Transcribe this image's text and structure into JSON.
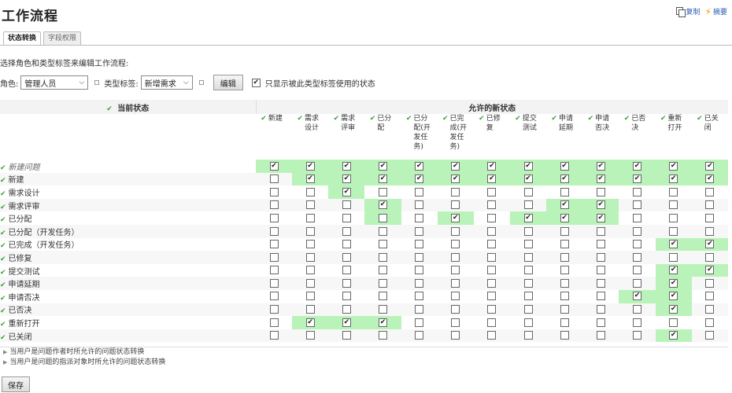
{
  "page_title": "工作流程",
  "top_actions": {
    "copy": "复制",
    "extra": "摘要"
  },
  "tabs": [
    {
      "label": "状态转换",
      "active": true
    },
    {
      "label": "字段权限",
      "active": false
    }
  ],
  "intro_text": "选择角色和类型标签来编辑工作流程:",
  "filters": {
    "role_label": "角色:",
    "role_value": "管理人员",
    "type_label": "类型标签:",
    "type_value": "新增需求",
    "edit_button": "编辑",
    "only_show_label": "只显示被此类型标签使用的状态",
    "only_show_checked": true
  },
  "table": {
    "current_header": "当前状态",
    "allowed_header": "允许的新状态",
    "columns": [
      "新建",
      "需求设计",
      "需求评审",
      "已分配",
      "已分配(开发任务)",
      "已完成(开发任务)",
      "已修复",
      "提交测试",
      "申请延期",
      "申请否决",
      "已否决",
      "重新打开",
      "已关闭"
    ],
    "rows": [
      {
        "name": "新建问题",
        "italic": true,
        "checked": [
          1,
          1,
          1,
          1,
          1,
          1,
          1,
          1,
          1,
          1,
          1,
          1,
          1
        ],
        "highlight": [
          1,
          1,
          1,
          1,
          1,
          1,
          1,
          1,
          1,
          1,
          1,
          1,
          1
        ]
      },
      {
        "name": "新建",
        "checked": [
          0,
          1,
          1,
          1,
          1,
          1,
          1,
          1,
          1,
          1,
          1,
          1,
          1
        ],
        "highlight": [
          0,
          1,
          1,
          1,
          1,
          1,
          1,
          1,
          1,
          1,
          1,
          1,
          1
        ]
      },
      {
        "name": "需求设计",
        "checked": [
          0,
          0,
          1,
          0,
          0,
          0,
          0,
          0,
          0,
          0,
          0,
          0,
          0
        ],
        "highlight": [
          0,
          0,
          1,
          0,
          0,
          0,
          0,
          0,
          0,
          0,
          0,
          0,
          0
        ]
      },
      {
        "name": "需求评审",
        "checked": [
          0,
          0,
          0,
          1,
          0,
          0,
          0,
          0,
          1,
          1,
          0,
          0,
          0
        ],
        "highlight": [
          0,
          0,
          0,
          1,
          0,
          0,
          0,
          0,
          1,
          1,
          0,
          0,
          0
        ]
      },
      {
        "name": "已分配",
        "checked": [
          0,
          0,
          0,
          0,
          0,
          1,
          0,
          1,
          1,
          1,
          0,
          0,
          0
        ],
        "highlight": [
          0,
          0,
          0,
          1,
          0,
          1,
          0,
          1,
          1,
          1,
          0,
          0,
          0
        ]
      },
      {
        "name": "已分配（开发任务）",
        "checked": [
          0,
          0,
          0,
          0,
          0,
          0,
          0,
          0,
          0,
          0,
          0,
          0,
          0
        ],
        "highlight": [
          0,
          0,
          0,
          0,
          0,
          0,
          0,
          0,
          0,
          0,
          0,
          0,
          0
        ]
      },
      {
        "name": "已完成（开发任务）",
        "checked": [
          0,
          0,
          0,
          0,
          0,
          0,
          0,
          0,
          0,
          0,
          0,
          1,
          1
        ],
        "highlight": [
          0,
          0,
          0,
          0,
          0,
          0,
          0,
          0,
          0,
          0,
          0,
          1,
          1
        ]
      },
      {
        "name": "已修复",
        "checked": [
          0,
          0,
          0,
          0,
          0,
          0,
          0,
          0,
          0,
          0,
          0,
          0,
          0
        ],
        "highlight": [
          0,
          0,
          0,
          0,
          0,
          0,
          0,
          0,
          0,
          0,
          0,
          0,
          0
        ]
      },
      {
        "name": "提交测试",
        "checked": [
          0,
          0,
          0,
          0,
          0,
          0,
          0,
          0,
          0,
          0,
          0,
          1,
          1
        ],
        "highlight": [
          0,
          0,
          0,
          0,
          0,
          0,
          0,
          0,
          0,
          0,
          0,
          1,
          1
        ]
      },
      {
        "name": "申请延期",
        "checked": [
          0,
          0,
          0,
          0,
          0,
          0,
          0,
          0,
          0,
          0,
          0,
          1,
          0
        ],
        "highlight": [
          0,
          0,
          0,
          0,
          0,
          0,
          0,
          0,
          0,
          0,
          0,
          1,
          0
        ]
      },
      {
        "name": "申请否决",
        "checked": [
          0,
          0,
          0,
          0,
          0,
          0,
          0,
          0,
          0,
          0,
          1,
          1,
          0
        ],
        "highlight": [
          0,
          0,
          0,
          0,
          0,
          0,
          0,
          0,
          0,
          0,
          1,
          1,
          0
        ]
      },
      {
        "name": "已否决",
        "checked": [
          0,
          0,
          0,
          0,
          0,
          0,
          0,
          0,
          0,
          0,
          0,
          1,
          0
        ],
        "highlight": [
          0,
          0,
          0,
          0,
          0,
          0,
          0,
          0,
          0,
          0,
          0,
          1,
          0
        ]
      },
      {
        "name": "重新打开",
        "checked": [
          0,
          1,
          1,
          1,
          0,
          0,
          0,
          0,
          0,
          0,
          0,
          0,
          0
        ],
        "highlight": [
          0,
          1,
          1,
          1,
          0,
          0,
          0,
          0,
          0,
          0,
          0,
          0,
          0
        ]
      },
      {
        "name": "已关闭",
        "checked": [
          0,
          0,
          0,
          0,
          0,
          0,
          0,
          0,
          0,
          0,
          0,
          1,
          0
        ],
        "highlight": [
          0,
          0,
          0,
          0,
          0,
          0,
          0,
          0,
          0,
          0,
          0,
          1,
          0
        ]
      }
    ]
  },
  "notes": [
    "当用户是问题作者时所允许的问题状态转换",
    "当用户是问题的指派对象时所允许的问题状态转换"
  ],
  "save_button": "保存",
  "colors": {
    "highlight": "#b9f3b9",
    "check_green": "#3aa43a",
    "link_blue": "#2a5db0"
  },
  "icons": {
    "check": "✔",
    "copy": "copy-icon",
    "bolt": "bolt-icon",
    "chevron": "chevron-down-icon",
    "triangle": "expand-triangle-icon"
  }
}
